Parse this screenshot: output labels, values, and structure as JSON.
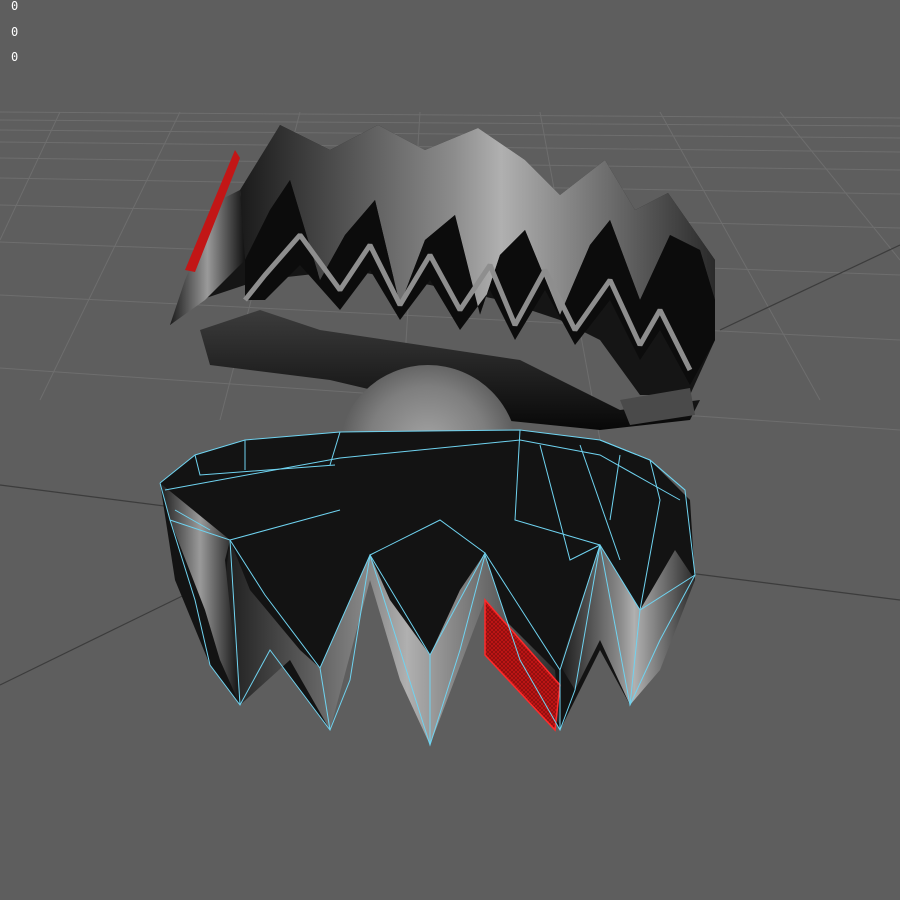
{
  "viewport": {
    "hud_values": [
      "0",
      "0",
      "0"
    ]
  },
  "scene": {
    "objects": [
      "shell-top-icon",
      "shell-bottom-icon",
      "pearl-sphere-icon"
    ],
    "colors": {
      "background": "#5e5e5e",
      "grid": "#707070",
      "wireframe_selected": "#6fd3f0",
      "face_selected": "#d01818",
      "pearl": "#8a8a8a"
    }
  }
}
